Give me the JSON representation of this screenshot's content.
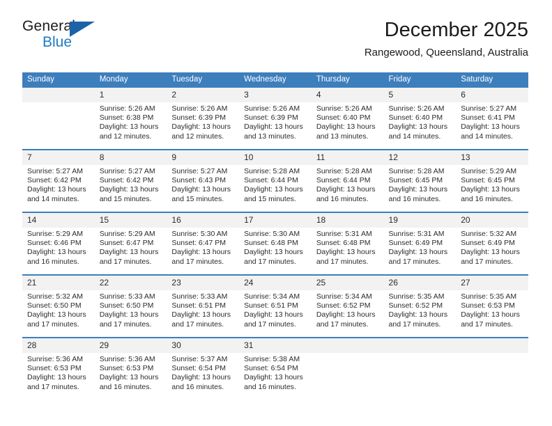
{
  "brand": {
    "name_part1": "General",
    "name_part2": "Blue",
    "accent_color": "#1f7ac0",
    "triangle_color": "#1b62a8"
  },
  "header": {
    "title": "December 2025",
    "location": "Rangewood, Queensland, Australia"
  },
  "theme": {
    "header_blue": "#3d7ebd",
    "daynum_background": "#f2f2f2",
    "text_color": "#2b2b2b"
  },
  "weekday_headers": [
    "Sunday",
    "Monday",
    "Tuesday",
    "Wednesday",
    "Thursday",
    "Friday",
    "Saturday"
  ],
  "weeks": [
    {
      "days": [
        {
          "num": "",
          "blank": true,
          "sunrise": "",
          "sunset": "",
          "daylight_line1": "",
          "daylight_line2": ""
        },
        {
          "num": "1",
          "sunrise": "Sunrise: 5:26 AM",
          "sunset": "Sunset: 6:38 PM",
          "daylight_line1": "Daylight: 13 hours",
          "daylight_line2": "and 12 minutes."
        },
        {
          "num": "2",
          "sunrise": "Sunrise: 5:26 AM",
          "sunset": "Sunset: 6:39 PM",
          "daylight_line1": "Daylight: 13 hours",
          "daylight_line2": "and 12 minutes."
        },
        {
          "num": "3",
          "sunrise": "Sunrise: 5:26 AM",
          "sunset": "Sunset: 6:39 PM",
          "daylight_line1": "Daylight: 13 hours",
          "daylight_line2": "and 13 minutes."
        },
        {
          "num": "4",
          "sunrise": "Sunrise: 5:26 AM",
          "sunset": "Sunset: 6:40 PM",
          "daylight_line1": "Daylight: 13 hours",
          "daylight_line2": "and 13 minutes."
        },
        {
          "num": "5",
          "sunrise": "Sunrise: 5:26 AM",
          "sunset": "Sunset: 6:40 PM",
          "daylight_line1": "Daylight: 13 hours",
          "daylight_line2": "and 14 minutes."
        },
        {
          "num": "6",
          "sunrise": "Sunrise: 5:27 AM",
          "sunset": "Sunset: 6:41 PM",
          "daylight_line1": "Daylight: 13 hours",
          "daylight_line2": "and 14 minutes."
        }
      ]
    },
    {
      "days": [
        {
          "num": "7",
          "sunrise": "Sunrise: 5:27 AM",
          "sunset": "Sunset: 6:42 PM",
          "daylight_line1": "Daylight: 13 hours",
          "daylight_line2": "and 14 minutes."
        },
        {
          "num": "8",
          "sunrise": "Sunrise: 5:27 AM",
          "sunset": "Sunset: 6:42 PM",
          "daylight_line1": "Daylight: 13 hours",
          "daylight_line2": "and 15 minutes."
        },
        {
          "num": "9",
          "sunrise": "Sunrise: 5:27 AM",
          "sunset": "Sunset: 6:43 PM",
          "daylight_line1": "Daylight: 13 hours",
          "daylight_line2": "and 15 minutes."
        },
        {
          "num": "10",
          "sunrise": "Sunrise: 5:28 AM",
          "sunset": "Sunset: 6:44 PM",
          "daylight_line1": "Daylight: 13 hours",
          "daylight_line2": "and 15 minutes."
        },
        {
          "num": "11",
          "sunrise": "Sunrise: 5:28 AM",
          "sunset": "Sunset: 6:44 PM",
          "daylight_line1": "Daylight: 13 hours",
          "daylight_line2": "and 16 minutes."
        },
        {
          "num": "12",
          "sunrise": "Sunrise: 5:28 AM",
          "sunset": "Sunset: 6:45 PM",
          "daylight_line1": "Daylight: 13 hours",
          "daylight_line2": "and 16 minutes."
        },
        {
          "num": "13",
          "sunrise": "Sunrise: 5:29 AM",
          "sunset": "Sunset: 6:45 PM",
          "daylight_line1": "Daylight: 13 hours",
          "daylight_line2": "and 16 minutes."
        }
      ]
    },
    {
      "days": [
        {
          "num": "14",
          "sunrise": "Sunrise: 5:29 AM",
          "sunset": "Sunset: 6:46 PM",
          "daylight_line1": "Daylight: 13 hours",
          "daylight_line2": "and 16 minutes."
        },
        {
          "num": "15",
          "sunrise": "Sunrise: 5:29 AM",
          "sunset": "Sunset: 6:47 PM",
          "daylight_line1": "Daylight: 13 hours",
          "daylight_line2": "and 17 minutes."
        },
        {
          "num": "16",
          "sunrise": "Sunrise: 5:30 AM",
          "sunset": "Sunset: 6:47 PM",
          "daylight_line1": "Daylight: 13 hours",
          "daylight_line2": "and 17 minutes."
        },
        {
          "num": "17",
          "sunrise": "Sunrise: 5:30 AM",
          "sunset": "Sunset: 6:48 PM",
          "daylight_line1": "Daylight: 13 hours",
          "daylight_line2": "and 17 minutes."
        },
        {
          "num": "18",
          "sunrise": "Sunrise: 5:31 AM",
          "sunset": "Sunset: 6:48 PM",
          "daylight_line1": "Daylight: 13 hours",
          "daylight_line2": "and 17 minutes."
        },
        {
          "num": "19",
          "sunrise": "Sunrise: 5:31 AM",
          "sunset": "Sunset: 6:49 PM",
          "daylight_line1": "Daylight: 13 hours",
          "daylight_line2": "and 17 minutes."
        },
        {
          "num": "20",
          "sunrise": "Sunrise: 5:32 AM",
          "sunset": "Sunset: 6:49 PM",
          "daylight_line1": "Daylight: 13 hours",
          "daylight_line2": "and 17 minutes."
        }
      ]
    },
    {
      "days": [
        {
          "num": "21",
          "sunrise": "Sunrise: 5:32 AM",
          "sunset": "Sunset: 6:50 PM",
          "daylight_line1": "Daylight: 13 hours",
          "daylight_line2": "and 17 minutes."
        },
        {
          "num": "22",
          "sunrise": "Sunrise: 5:33 AM",
          "sunset": "Sunset: 6:50 PM",
          "daylight_line1": "Daylight: 13 hours",
          "daylight_line2": "and 17 minutes."
        },
        {
          "num": "23",
          "sunrise": "Sunrise: 5:33 AM",
          "sunset": "Sunset: 6:51 PM",
          "daylight_line1": "Daylight: 13 hours",
          "daylight_line2": "and 17 minutes."
        },
        {
          "num": "24",
          "sunrise": "Sunrise: 5:34 AM",
          "sunset": "Sunset: 6:51 PM",
          "daylight_line1": "Daylight: 13 hours",
          "daylight_line2": "and 17 minutes."
        },
        {
          "num": "25",
          "sunrise": "Sunrise: 5:34 AM",
          "sunset": "Sunset: 6:52 PM",
          "daylight_line1": "Daylight: 13 hours",
          "daylight_line2": "and 17 minutes."
        },
        {
          "num": "26",
          "sunrise": "Sunrise: 5:35 AM",
          "sunset": "Sunset: 6:52 PM",
          "daylight_line1": "Daylight: 13 hours",
          "daylight_line2": "and 17 minutes."
        },
        {
          "num": "27",
          "sunrise": "Sunrise: 5:35 AM",
          "sunset": "Sunset: 6:53 PM",
          "daylight_line1": "Daylight: 13 hours",
          "daylight_line2": "and 17 minutes."
        }
      ]
    },
    {
      "days": [
        {
          "num": "28",
          "sunrise": "Sunrise: 5:36 AM",
          "sunset": "Sunset: 6:53 PM",
          "daylight_line1": "Daylight: 13 hours",
          "daylight_line2": "and 17 minutes."
        },
        {
          "num": "29",
          "sunrise": "Sunrise: 5:36 AM",
          "sunset": "Sunset: 6:53 PM",
          "daylight_line1": "Daylight: 13 hours",
          "daylight_line2": "and 16 minutes."
        },
        {
          "num": "30",
          "sunrise": "Sunrise: 5:37 AM",
          "sunset": "Sunset: 6:54 PM",
          "daylight_line1": "Daylight: 13 hours",
          "daylight_line2": "and 16 minutes."
        },
        {
          "num": "31",
          "sunrise": "Sunrise: 5:38 AM",
          "sunset": "Sunset: 6:54 PM",
          "daylight_line1": "Daylight: 13 hours",
          "daylight_line2": "and 16 minutes."
        },
        {
          "num": "",
          "blank": true,
          "sunrise": "",
          "sunset": "",
          "daylight_line1": "",
          "daylight_line2": ""
        },
        {
          "num": "",
          "blank": true,
          "sunrise": "",
          "sunset": "",
          "daylight_line1": "",
          "daylight_line2": ""
        },
        {
          "num": "",
          "blank": true,
          "sunrise": "",
          "sunset": "",
          "daylight_line1": "",
          "daylight_line2": ""
        }
      ]
    }
  ]
}
